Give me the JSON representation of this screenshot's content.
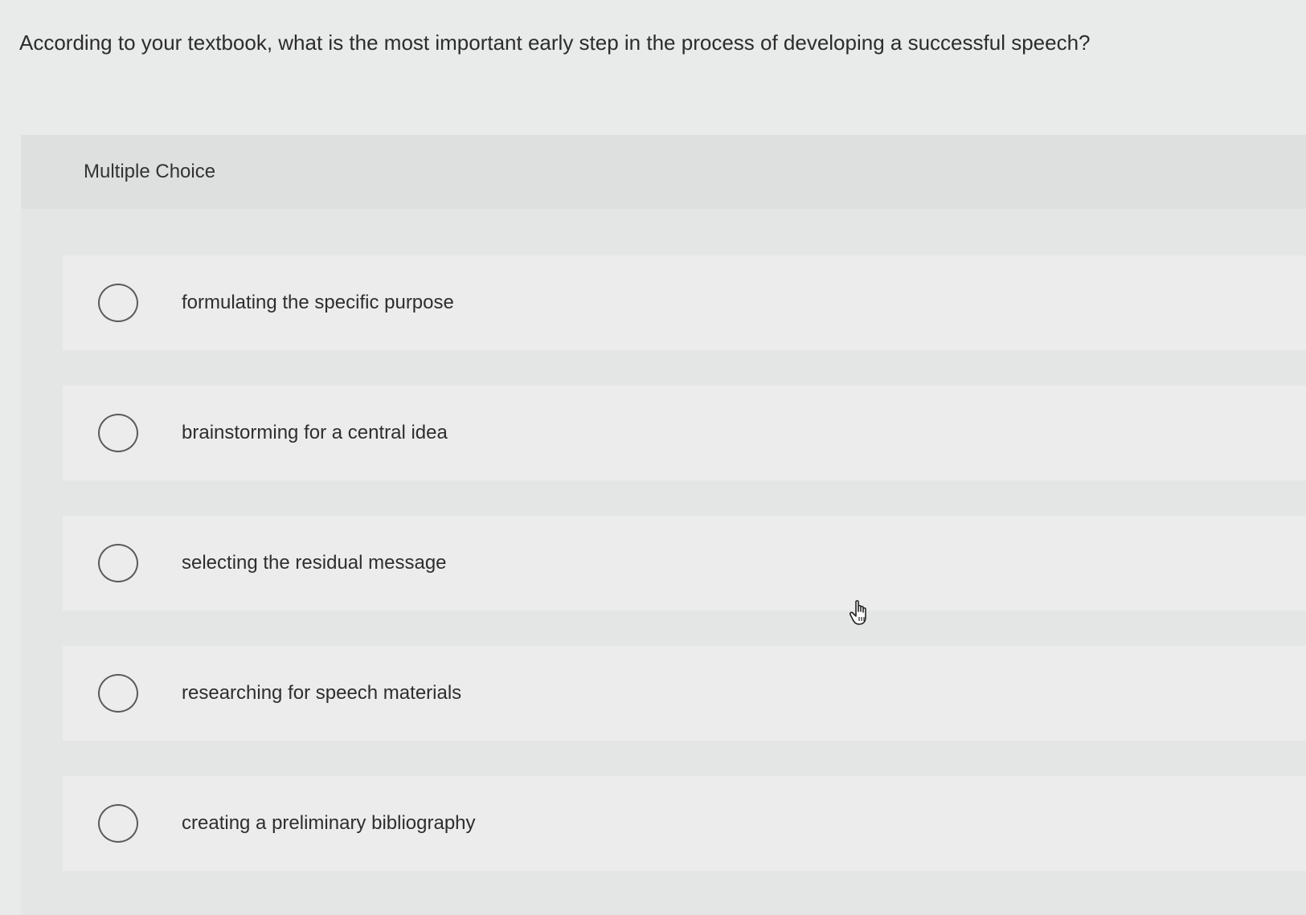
{
  "question": {
    "text": "According to your textbook, what is the most important early step in the process of developing a successful speech?"
  },
  "panel": {
    "header_label": "Multiple Choice"
  },
  "options": [
    {
      "label": "formulating the specific purpose",
      "selected": false
    },
    {
      "label": "brainstorming for a central idea",
      "selected": false
    },
    {
      "label": "selecting the residual message",
      "selected": false
    },
    {
      "label": "researching for speech materials",
      "selected": false
    },
    {
      "label": "creating a preliminary bibliography",
      "selected": false
    }
  ],
  "cursor": {
    "icon": "hand-pointer-icon"
  }
}
